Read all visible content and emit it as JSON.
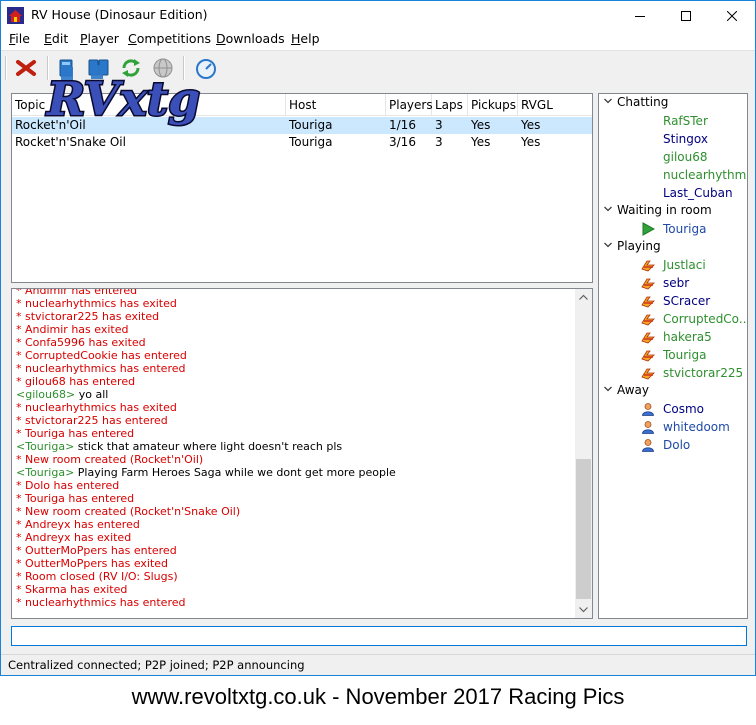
{
  "window": {
    "title": "RV House (Dinosaur Edition)"
  },
  "menu": [
    {
      "label": "File",
      "accel": "F",
      "rest": "ile"
    },
    {
      "label": "Edit",
      "accel": "E",
      "rest": "dit"
    },
    {
      "label": "Player",
      "accel": "P",
      "rest": "layer"
    },
    {
      "label": "Competitions",
      "accel": "C",
      "rest": "ompetitions"
    },
    {
      "label": "Downloads",
      "accel": "D",
      "rest": "ownloads"
    },
    {
      "label": "Help",
      "accel": "H",
      "rest": "elp"
    }
  ],
  "logo_text": "RVxtg",
  "room_table": {
    "columns": [
      "Topic",
      "Host",
      "Players",
      "Laps",
      "Pickups",
      "RVGL"
    ],
    "rows": [
      [
        "Rocket'n'Oil",
        "Touriga",
        "1/16",
        "3",
        "Yes",
        "Yes"
      ],
      [
        "Rocket'n'Snake Oil",
        "Touriga",
        "3/16",
        "3",
        "Yes",
        "Yes"
      ]
    ],
    "selected_row": 0
  },
  "chat_log": [
    {
      "type": "sys",
      "text": "* Andimir has entered"
    },
    {
      "type": "sys",
      "text": "* nuclearhythmics has exited"
    },
    {
      "type": "sys",
      "text": "* stvictorar225 has exited"
    },
    {
      "type": "sys",
      "text": "* Andimir has exited"
    },
    {
      "type": "sys",
      "text": "* Confa5996 has exited"
    },
    {
      "type": "sys",
      "text": "* CorruptedCookie has entered"
    },
    {
      "type": "sys",
      "text": "* nuclearhythmics has entered"
    },
    {
      "type": "sys",
      "text": "* gilou68 has entered"
    },
    {
      "type": "chat",
      "nick": "gilou68",
      "text": "yo all"
    },
    {
      "type": "sys",
      "text": "* nuclearhythmics has exited"
    },
    {
      "type": "sys",
      "text": "* stvictorar225 has entered"
    },
    {
      "type": "sys",
      "text": "* Touriga has entered"
    },
    {
      "type": "chat",
      "nick": "Touriga",
      "text": "stick that amateur where light doesn't reach pls"
    },
    {
      "type": "sys",
      "text": "* New room created (Rocket'n'Oil)"
    },
    {
      "type": "chat",
      "nick": "Touriga",
      "text": "Playing Farm Heroes Saga while we dont get more people"
    },
    {
      "type": "sys",
      "text": "* Dolo has entered"
    },
    {
      "type": "sys",
      "text": "* Touriga has entered"
    },
    {
      "type": "sys",
      "text": "* New room created (Rocket'n'Snake Oil)"
    },
    {
      "type": "sys",
      "text": "* Andreyx has entered"
    },
    {
      "type": "sys",
      "text": "* Andreyx has exited"
    },
    {
      "type": "sys",
      "text": "* OutterMoPpers has entered"
    },
    {
      "type": "sys",
      "text": "* OutterMoPpers has exited"
    },
    {
      "type": "sys",
      "text": "* Room closed (RV I/O: Slugs)"
    },
    {
      "type": "sys",
      "text": "* Skarma has exited"
    },
    {
      "type": "sys",
      "text": "* nuclearhythmics has entered"
    }
  ],
  "user_tree": [
    {
      "group": "Chatting",
      "users": [
        {
          "name": "RafSTer",
          "color": "#2f8f2f",
          "icon": "none"
        },
        {
          "name": "Stingox",
          "color": "#00007f",
          "icon": "none"
        },
        {
          "name": "gilou68",
          "color": "#2f8f2f",
          "icon": "none"
        },
        {
          "name": "nuclearhythmics",
          "color": "#2f8f2f",
          "icon": "none"
        },
        {
          "name": "Last_Cuban",
          "color": "#00007f",
          "icon": "none"
        }
      ]
    },
    {
      "group": "Waiting in room",
      "users": [
        {
          "name": "Touriga",
          "color": "#1f4aa8",
          "icon": "play-icon"
        }
      ]
    },
    {
      "group": "Playing",
      "users": [
        {
          "name": "Justlaci",
          "color": "#2f8f2f",
          "icon": "racing-car-icon"
        },
        {
          "name": "sebr",
          "color": "#00007f",
          "icon": "racing-car-icon"
        },
        {
          "name": "SCracer",
          "color": "#00007f",
          "icon": "racing-car-icon"
        },
        {
          "name": "CorruptedCo...",
          "color": "#2f8f2f",
          "icon": "racing-car-icon"
        },
        {
          "name": "hakera5",
          "color": "#2f8f2f",
          "icon": "racing-car-icon"
        },
        {
          "name": "Touriga",
          "color": "#2f8f2f",
          "icon": "racing-car-icon"
        },
        {
          "name": "stvictorar225",
          "color": "#2f8f2f",
          "icon": "racing-car-icon"
        }
      ]
    },
    {
      "group": "Away",
      "users": [
        {
          "name": "Cosmo",
          "color": "#00007f",
          "icon": "away-user-icon"
        },
        {
          "name": "whitedoom",
          "color": "#1f4aa8",
          "icon": "away-user-icon"
        },
        {
          "name": "Dolo",
          "color": "#1f4aa8",
          "icon": "away-user-icon"
        }
      ]
    }
  ],
  "chat_input": {
    "value": ""
  },
  "status": "Centralized connected; P2P joined; P2P announcing",
  "caption": "www.revoltxtg.co.uk - November 2017 Racing Pics",
  "colors": {
    "system": "#d80000",
    "nick": "#2f8f2f",
    "selection": "#cce8ff",
    "accent": "#0078d7"
  }
}
